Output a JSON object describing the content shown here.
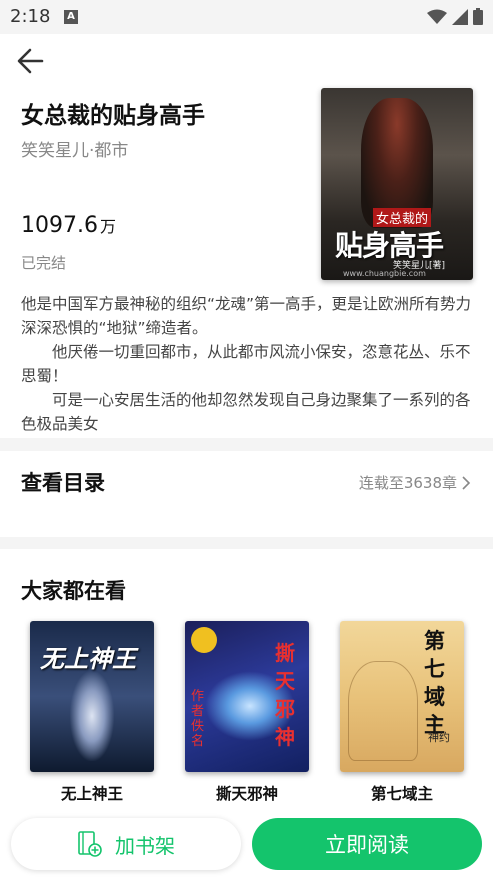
{
  "status_bar": {
    "time": "2:18",
    "notification_letter": "A"
  },
  "book": {
    "title": "女总裁的贴身高手",
    "meta": "笑笑星儿·都市",
    "count_number": "1097.6",
    "count_unit": "万",
    "status": "已完结",
    "cover": {
      "title_small": "女总裁的",
      "title_large": "贴身高手",
      "author_tag": "笑笑星儿[著]",
      "watermark": "www.chuangbie.com"
    },
    "intro": [
      "他是中国军方最神秘的组织“龙魂”第一高手，更是让欧洲所有势力深深恐惧的“地狱”缔造者。",
      "他厌倦一切重回都市，从此都市风流小保安，恣意花丛、乐不思蜀！",
      "可是一心安居生活的他却忽然发现自己身边聚集了一系列的各色极品美女"
    ]
  },
  "toc": {
    "title": "查看目录",
    "status": "连载至3638章"
  },
  "recommend": {
    "title": "大家都在看",
    "items": [
      {
        "name": "无上神王",
        "cover_text": "无上神王",
        "cover_sub": ""
      },
      {
        "name": "撕天邪神",
        "cover_text": "撕天邪神",
        "cover_sub": "作者佚名"
      },
      {
        "name": "第七域主",
        "cover_text": "第七域主",
        "cover_sub": "神约"
      }
    ]
  },
  "actions": {
    "add_shelf": "加书架",
    "read_now": "立即阅读"
  },
  "colors": {
    "accent": "#14c46c",
    "background": "#f4f4f4"
  }
}
